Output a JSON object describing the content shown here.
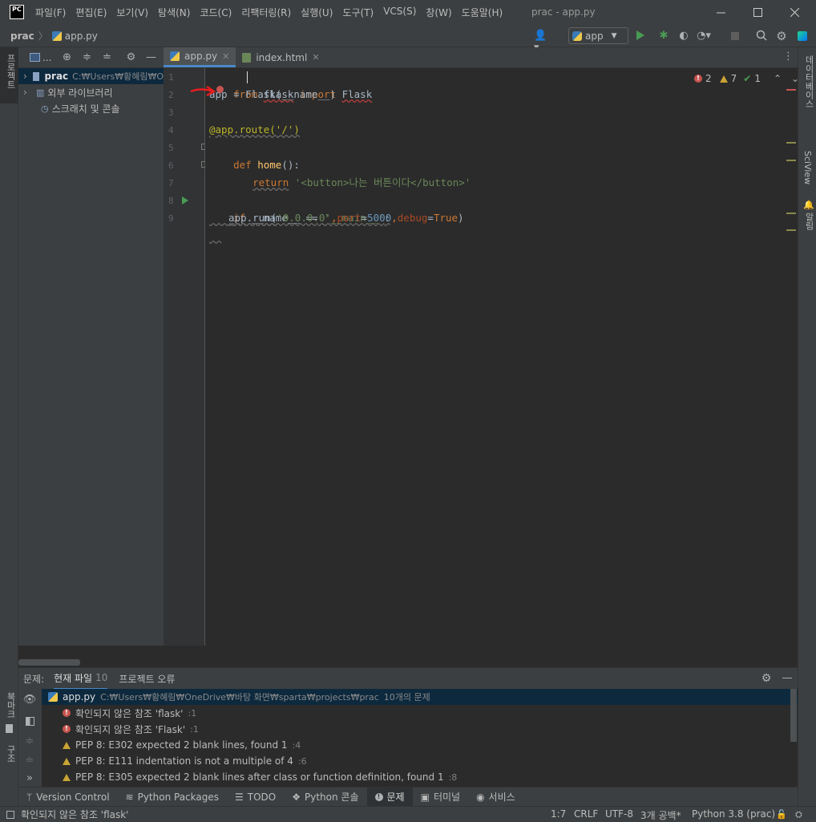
{
  "window": {
    "logo": "PC",
    "title": "prac - app.py",
    "menu": [
      "파일(F)",
      "편집(E)",
      "보기(V)",
      "탐색(N)",
      "코드(C)",
      "리팩터링(R)",
      "실행(U)",
      "도구(T)",
      "VCS(S)",
      "창(W)",
      "도움말(H)"
    ]
  },
  "navbar": {
    "breadcrumb_project": "prac",
    "breadcrumb_file": "app.py",
    "run_config": "app"
  },
  "left_tools": {
    "project": "프로젝트",
    "bookmarks": "북마크",
    "structure": "구조"
  },
  "right_tools": {
    "database": "데이터베이스",
    "sciview": "SciView",
    "notifications": "알림"
  },
  "project": {
    "header_label": "...",
    "items": [
      {
        "label": "prac",
        "path": "C:₩Users₩황혜림₩O"
      },
      {
        "label": "외부 라이브러리"
      },
      {
        "label": "스크래치 및 콘솔"
      }
    ]
  },
  "tabs": [
    {
      "label": "app.py"
    },
    {
      "label": "index.html"
    }
  ],
  "inspection": {
    "errors": "2",
    "warnings": "7",
    "ok": "1"
  },
  "code": {
    "line_numbers": [
      "1",
      "2",
      "3",
      "4",
      "5",
      "6",
      "7",
      "8",
      "9"
    ],
    "l1": {
      "kw1": "from",
      "mod": "flask",
      "kw2": "import",
      "cls": "Flask"
    },
    "l2": {
      "text": "app = Flask(__name__)"
    },
    "l4": {
      "text": "@app.route('/')"
    },
    "l5": {
      "kw": "def",
      "fn": "home",
      "rest": "():"
    },
    "l6": {
      "kw": "return",
      "str": "'<button>나는 버튼이다</button>'"
    },
    "l8": {
      "kw": "if",
      "mid": "__name__ ==",
      "str": "'__main__'",
      "end": ":"
    },
    "l9": {
      "a": "app.run(",
      "s": "'0.0.0.0'",
      "b": ",",
      "p": "port",
      "eq": "=",
      "n": "5000",
      "c": ",",
      "d": "debug",
      "eq2": "=",
      "t": "True",
      "e": ")"
    }
  },
  "problems": {
    "label": "문제:",
    "tab_current": "현재 파일",
    "tab_current_count": "10",
    "tab_project": "프로젝트 오류",
    "file": {
      "name": "app.py",
      "path": "C:₩Users₩황혜림₩OneDrive₩바탕 화면₩sparta₩projects₩prac",
      "summary": "10개의 문제"
    },
    "items": [
      {
        "type": "error",
        "text": "확인되지 않은 참조 'flask'",
        "ref": ":1"
      },
      {
        "type": "error",
        "text": "확인되지 않은 참조 'Flask'",
        "ref": ":1"
      },
      {
        "type": "warning",
        "text": "PEP 8: E302 expected 2 blank lines, found 1",
        "ref": ":4"
      },
      {
        "type": "warning",
        "text": "PEP 8: E111 indentation is not a multiple of 4",
        "ref": ":6"
      },
      {
        "type": "warning",
        "text": "PEP 8: E305 expected 2 blank lines after class or function definition, found 1",
        "ref": ":8"
      }
    ]
  },
  "bottom_tabs": [
    "Version Control",
    "Python Packages",
    "TODO",
    "Python 콘솔",
    "문제",
    "터미널",
    "서비스"
  ],
  "status": {
    "message": "확인되지 않은 참조 'flask'",
    "position": "1:7",
    "line_sep": "CRLF",
    "encoding": "UTF-8",
    "indent": "3개 공백*",
    "interpreter": "Python 3.8 (prac)"
  }
}
